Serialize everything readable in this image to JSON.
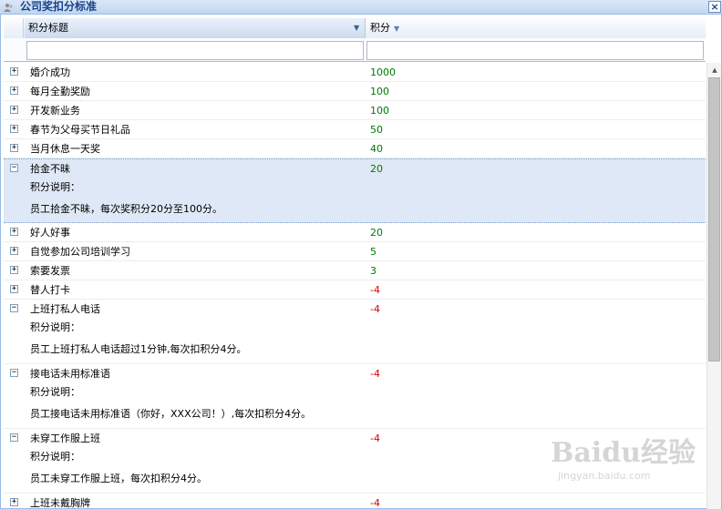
{
  "window": {
    "title": "公司奖扣分标准",
    "close_label": "×"
  },
  "columns": {
    "title": "积分标题",
    "points": "积分",
    "sort_icon": "▼",
    "menu_icon": "▼"
  },
  "expand_glyph": "+",
  "collapse_glyph": "−",
  "rows": [
    {
      "title": "婚介成功",
      "points": "1000",
      "expanded": false
    },
    {
      "title": "每月全勤奖励",
      "points": "100",
      "expanded": false
    },
    {
      "title": "开发新业务",
      "points": "100",
      "expanded": false
    },
    {
      "title": "春节为父母买节日礼品",
      "points": "50",
      "expanded": false
    },
    {
      "title": "当月休息一天奖",
      "points": "40",
      "expanded": false
    },
    {
      "title": "拾金不昧",
      "points": "20",
      "expanded": true,
      "selected": true,
      "desc_label": "积分说明：",
      "desc": "员工拾金不昧，每次奖积分20分至100分。"
    },
    {
      "title": "好人好事",
      "points": "20",
      "expanded": false
    },
    {
      "title": "自觉参加公司培训学习",
      "points": "5",
      "expanded": false
    },
    {
      "title": "索要发票",
      "points": "3",
      "expanded": false
    },
    {
      "title": "替人打卡",
      "points": "-4",
      "expanded": false
    },
    {
      "title": "上班打私人电话",
      "points": "-4",
      "expanded": true,
      "desc_label": "积分说明：",
      "desc": "员工上班打私人电话超过1分钟,每次扣积分4分。"
    },
    {
      "title": "接电话未用标准语",
      "points": "-4",
      "expanded": true,
      "desc_label": "积分说明：",
      "desc": "员工接电话未用标准语（你好，XXX公司！）,每次扣积分4分。"
    },
    {
      "title": "未穿工作服上班",
      "points": "-4",
      "expanded": true,
      "desc_label": "积分说明：",
      "desc": "员工未穿工作服上班，每次扣积分4分。"
    },
    {
      "title": "上班未戴胸牌",
      "points": "-4",
      "expanded": false
    }
  ],
  "watermark": {
    "main": "Baidu经验",
    "sub": "jingyan.baidu.com"
  },
  "colors": {
    "positive": "#007a00",
    "negative": "#dd0000",
    "header_text": "#15428b"
  }
}
